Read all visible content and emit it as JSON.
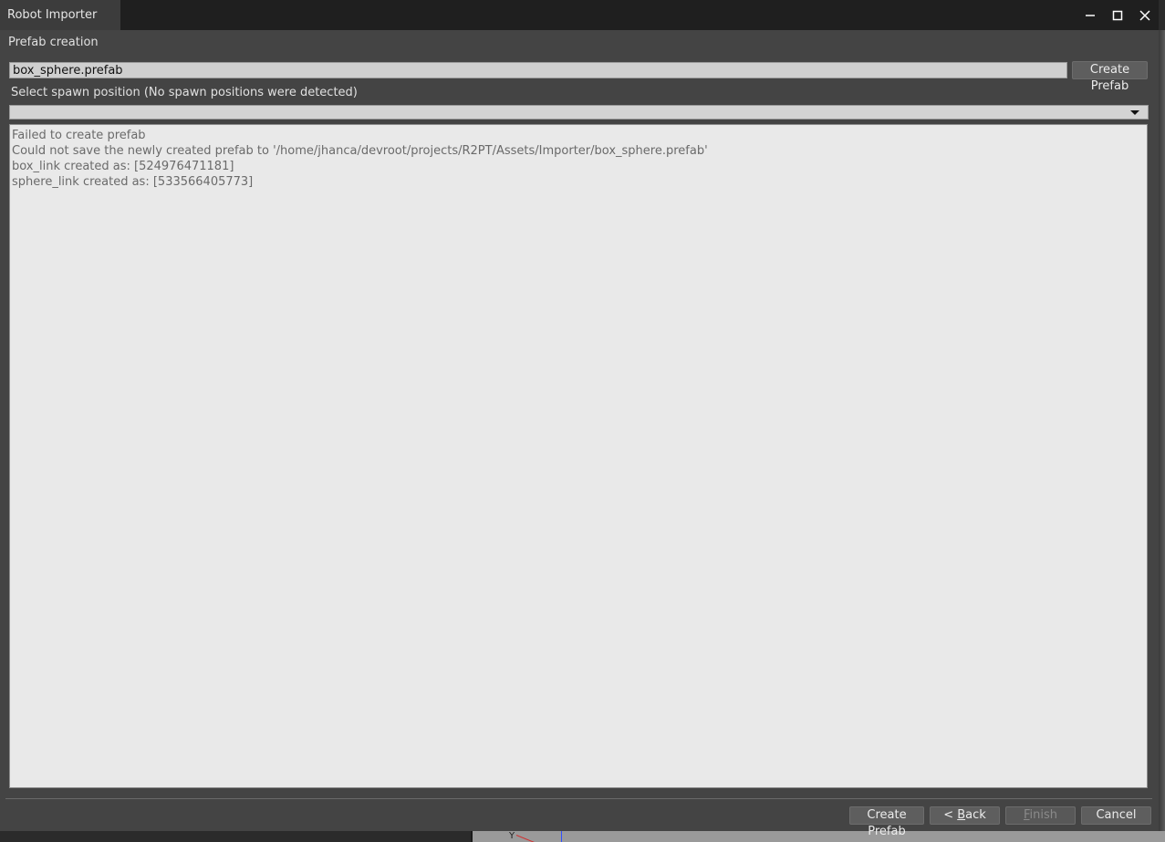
{
  "window": {
    "title": "Robot Importer"
  },
  "page": {
    "heading": "Prefab creation",
    "prefab_name_value": "box_sphere.prefab",
    "create_prefab_label": "Create Prefab",
    "spawn_label": "Select spawn position (No spawn positions were detected)",
    "spawn_selected": ""
  },
  "log": {
    "lines": [
      "Failed to create prefab",
      "Could not save the newly created prefab to '/home/jhanca/devroot/projects/R2PT/Assets/Importer/box_sphere.prefab'",
      "box_link created as: [524976471181]",
      "sphere_link created as: [533566405773]"
    ]
  },
  "footer": {
    "create_prefab_label": "Create Prefab",
    "back_prefix": "< ",
    "back_mnemonic": "B",
    "back_rest": "ack",
    "finish_mnemonic": "F",
    "finish_rest": "inish",
    "cancel_label": "Cancel"
  },
  "background": {
    "axis_label": "Y"
  },
  "icons": {
    "minimize": "minimize-icon",
    "maximize": "maximize-icon",
    "close": "close-icon",
    "dropdown": "chevron-down-icon"
  }
}
